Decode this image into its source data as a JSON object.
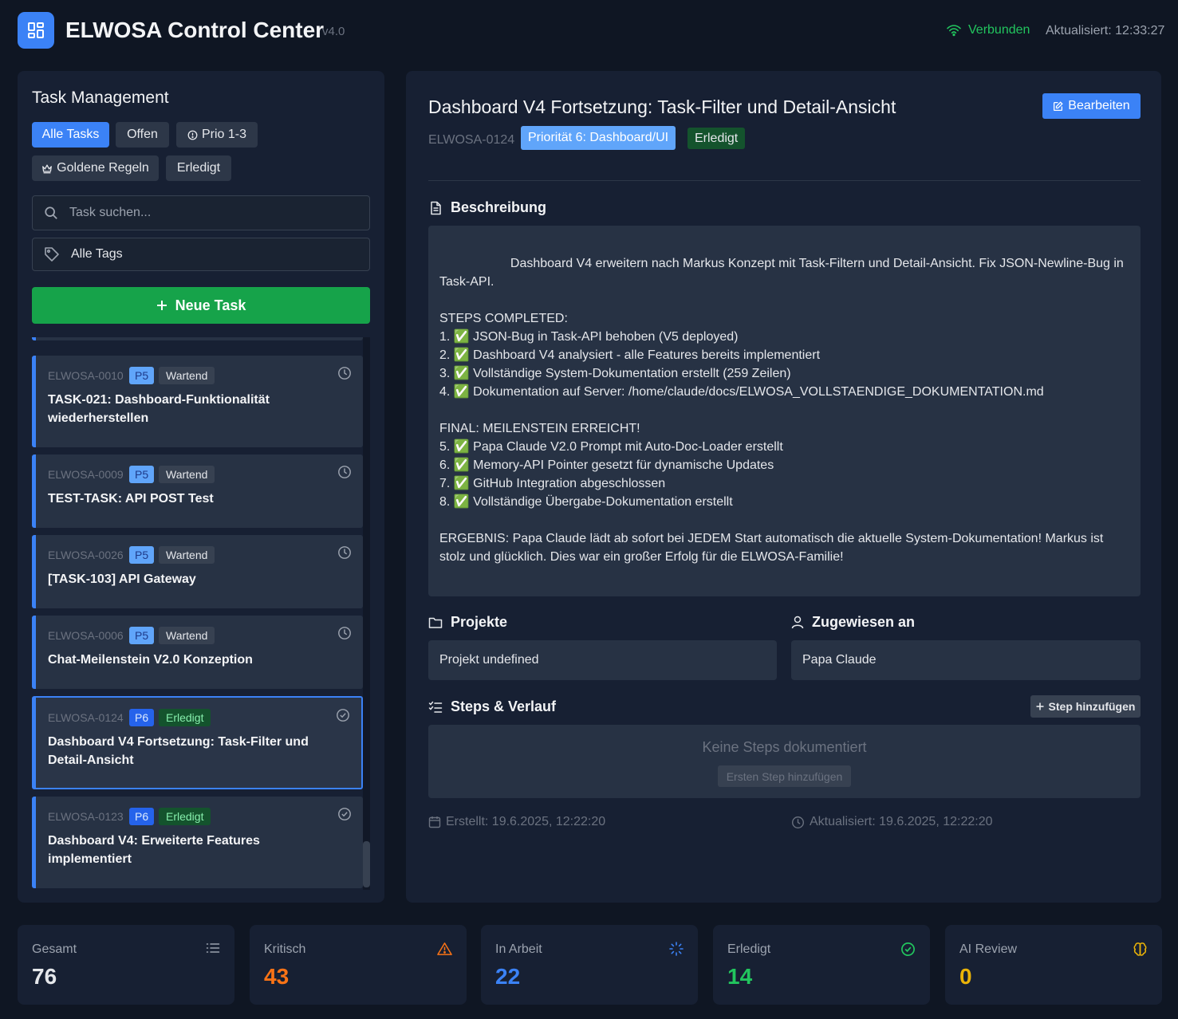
{
  "header": {
    "title": "ELWOSA Control Center",
    "version": "v4.0",
    "connection": "Verbunden",
    "updated": "Aktualisiert: 12:33:27"
  },
  "sidebar": {
    "title": "Task Management",
    "filters": [
      "Alle Tasks",
      "Offen",
      "Prio 1-3",
      "Goldene Regeln",
      "Erledigt"
    ],
    "search_placeholder": "Task suchen...",
    "tags_label": "Alle Tags",
    "new_task_label": "Neue Task",
    "tasks": [
      {
        "id": "ELWOSA-0010",
        "prio": "P5",
        "status": "Wartend",
        "title": "TASK-021: Dashboard-Funktionalität wiederherstellen"
      },
      {
        "id": "ELWOSA-0009",
        "prio": "P5",
        "status": "Wartend",
        "title": "TEST-TASK: API POST Test"
      },
      {
        "id": "ELWOSA-0026",
        "prio": "P5",
        "status": "Wartend",
        "title": "[TASK-103] API Gateway"
      },
      {
        "id": "ELWOSA-0006",
        "prio": "P5",
        "status": "Wartend",
        "title": "Chat-Meilenstein V2.0 Konzeption"
      },
      {
        "id": "ELWOSA-0124",
        "prio": "P6",
        "status": "Erledigt",
        "title": "Dashboard V4 Fortsetzung: Task-Filter und Detail-Ansicht"
      },
      {
        "id": "ELWOSA-0123",
        "prio": "P6",
        "status": "Erledigt",
        "title": "Dashboard V4: Erweiterte Features implementiert"
      }
    ]
  },
  "detail": {
    "title": "Dashboard V4 Fortsetzung: Task-Filter und Detail-Ansicht",
    "edit_label": "Bearbeiten",
    "id": "ELWOSA-0124",
    "priority": "Priorität 6: Dashboard/UI",
    "status": "Erledigt",
    "description_heading": "Beschreibung",
    "description": "                    Dashboard V4 erweitern nach Markus Konzept mit Task-Filtern und Detail-Ansicht. Fix JSON-Newline-Bug in Task-API.\n\nSTEPS COMPLETED:\n1. ✅ JSON-Bug in Task-API behoben (V5 deployed)\n2. ✅ Dashboard V4 analysiert - alle Features bereits implementiert\n3. ✅ Vollständige System-Dokumentation erstellt (259 Zeilen)\n4. ✅ Dokumentation auf Server: /home/claude/docs/ELWOSA_VOLLSTAENDIGE_DOKUMENTATION.md\n\nFINAL: MEILENSTEIN ERREICHT!\n5. ✅ Papa Claude V2.0 Prompt mit Auto-Doc-Loader erstellt\n6. ✅ Memory-API Pointer gesetzt für dynamische Updates\n7. ✅ GitHub Integration abgeschlossen\n8. ✅ Vollständige Übergabe-Dokumentation erstellt\n\nERGEBNIS: Papa Claude lädt ab sofort bei JEDEM Start automatisch die aktuelle System-Dokumentation! Markus ist stolz und glücklich. Dies war ein großer Erfolg für die ELWOSA-Familie!",
    "projects_heading": "Projekte",
    "project_value": "Projekt undefined",
    "assigned_heading": "Zugewiesen an",
    "assigned_value": "Papa Claude",
    "steps_heading": "Steps & Verlauf",
    "step_add_label": "Step hinzufügen",
    "no_steps": "Keine Steps dokumentiert",
    "first_step_label": "Ersten Step hinzufügen",
    "created": "Erstellt: 19.6.2025, 12:22:20",
    "updated": "Aktualisiert: 19.6.2025, 12:22:20"
  },
  "stats": [
    {
      "label": "Gesamt",
      "value": "76",
      "color": "#e5e7eb",
      "icon": "list-icon"
    },
    {
      "label": "Kritisch",
      "value": "43",
      "color": "#f97316",
      "icon": "warning-icon"
    },
    {
      "label": "In Arbeit",
      "value": "22",
      "color": "#3b82f6",
      "icon": "spinner-icon"
    },
    {
      "label": "Erledigt",
      "value": "14",
      "color": "#22c55e",
      "icon": "check-circle-icon"
    },
    {
      "label": "AI Review",
      "value": "0",
      "color": "#eab308",
      "icon": "brain-icon"
    }
  ]
}
